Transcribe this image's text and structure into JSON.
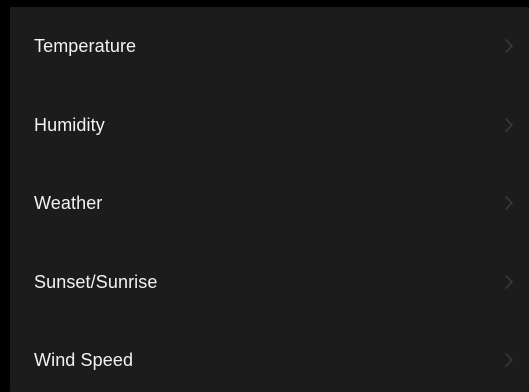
{
  "settings_list": {
    "items": [
      {
        "label": "Temperature",
        "icon": "chevron-right-icon"
      },
      {
        "label": "Humidity",
        "icon": "chevron-right-icon"
      },
      {
        "label": "Weather",
        "icon": "chevron-right-icon"
      },
      {
        "label": "Sunset/Sunrise",
        "icon": "chevron-right-icon"
      },
      {
        "label": "Wind Speed",
        "icon": "chevron-right-icon"
      }
    ]
  },
  "colors": {
    "background": "#000000",
    "list_background": "#1c1c1c",
    "label_text": "#f2f2f2",
    "chevron": "#3a3a3a"
  }
}
